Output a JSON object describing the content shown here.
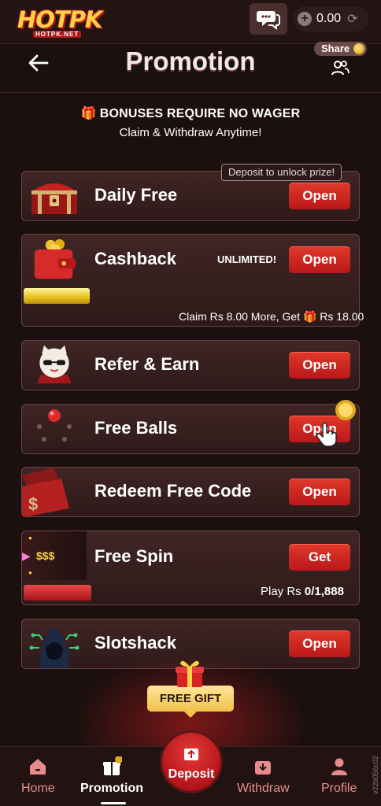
{
  "topbar": {
    "logo_main": "HOTPK",
    "logo_sub": "HOTPK.NET",
    "balance": "0.00"
  },
  "header": {
    "title": "Promotion",
    "share_label": "Share"
  },
  "notice": {
    "title": "BONUSES REQUIRE NO WAGER",
    "subtitle": "Claim & Withdraw Anytime!"
  },
  "promotions": [
    {
      "title": "Daily Free",
      "button": "Open",
      "tooltip": "Deposit to unlock prize!"
    },
    {
      "title": "Cashback",
      "button": "Open",
      "badge": "UNLIMITED!",
      "progress": 0.2,
      "footer_prefix": "Claim Rs 8.00 More, Get",
      "footer_reward": "Rs 18.00"
    },
    {
      "title": "Refer & Earn",
      "button": "Open"
    },
    {
      "title": "Free Balls",
      "button": "Open"
    },
    {
      "title": "Redeem Free Code",
      "button": "Open"
    },
    {
      "title": "Free Spin",
      "button": "Get",
      "progress": 0.2,
      "footer_label": "Play Rs",
      "footer_value": "0/1,888",
      "machine_label": "$$$"
    },
    {
      "title": "Slotshack",
      "button": "Open"
    }
  ],
  "free_gift": "FREE GIFT",
  "nav": {
    "home": "Home",
    "promotion": "Promotion",
    "deposit": "Deposit",
    "withdraw": "Withdraw",
    "profile": "Profile"
  },
  "version": "v22b056c02",
  "colors": {
    "accent_red": "#c9201f",
    "gold": "#ffd24a",
    "background": "#1c0f0f"
  }
}
